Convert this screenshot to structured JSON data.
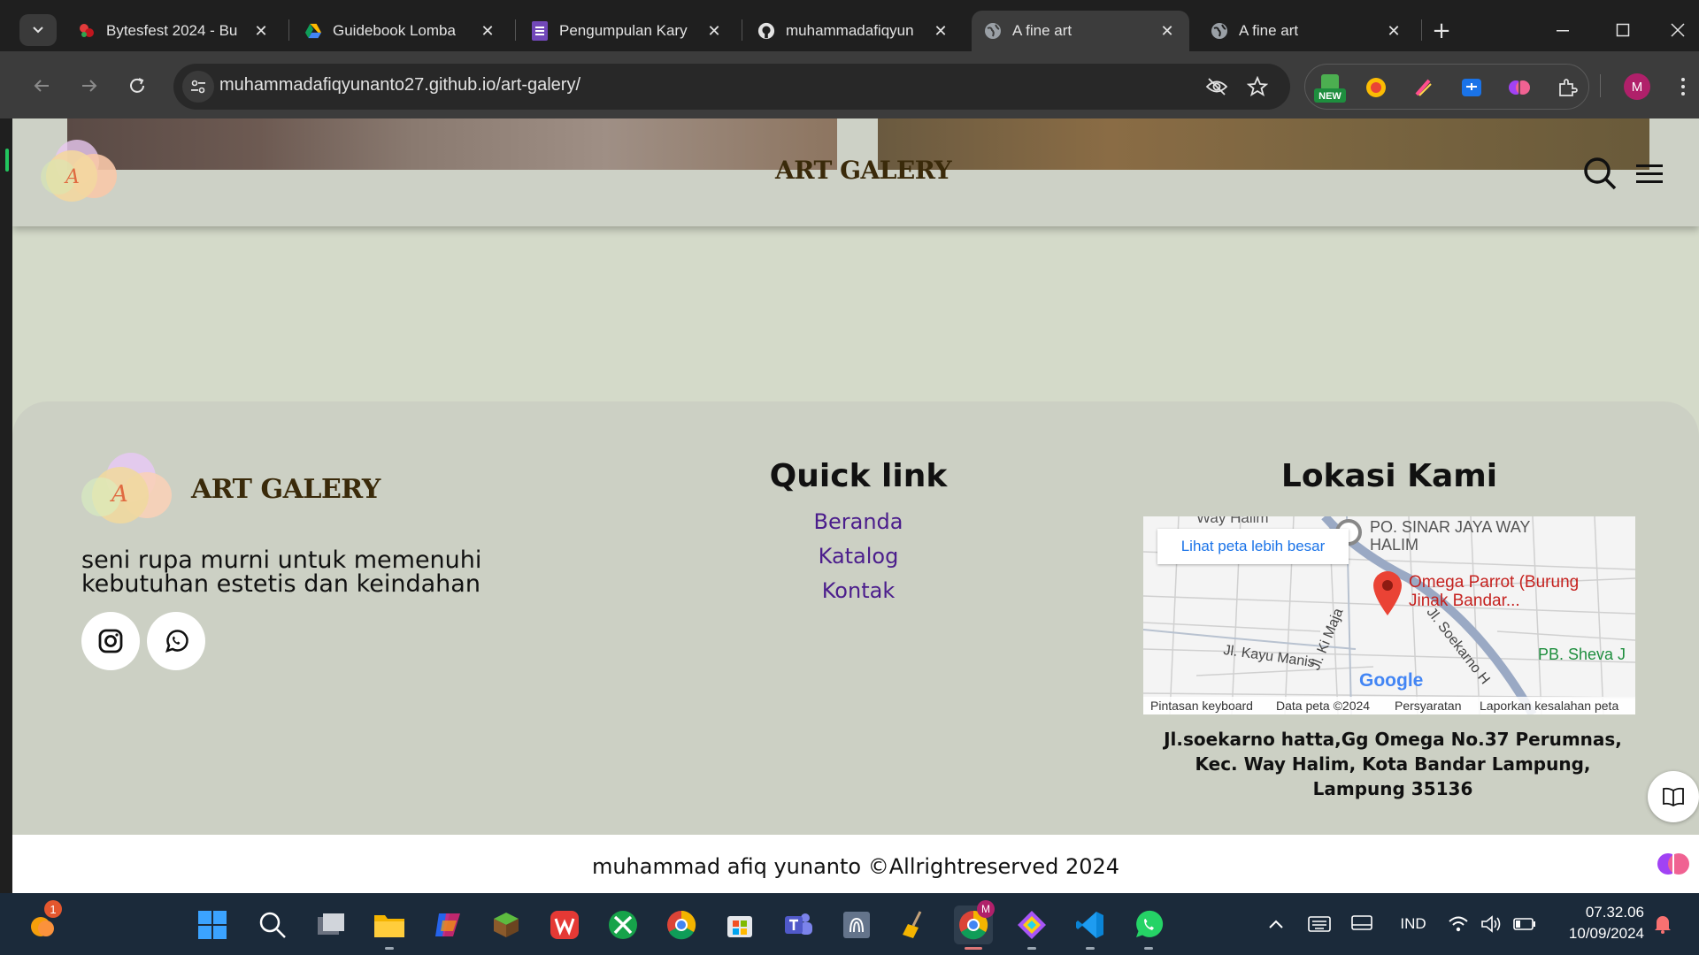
{
  "browser": {
    "tabs": [
      {
        "title": "Bytesfest 2024 - Bu",
        "icon": "bytesfest-favicon"
      },
      {
        "title": "Guidebook Lomba",
        "icon": "google-drive-icon"
      },
      {
        "title": "Pengumpulan Kary",
        "icon": "google-forms-icon"
      },
      {
        "title": "muhammadafiqyun",
        "icon": "github-icon"
      },
      {
        "title": "A fine art",
        "icon": "globe-icon",
        "active": true
      },
      {
        "title": "A fine art",
        "icon": "globe-icon"
      }
    ],
    "url": "muhammadafiqyunanto27.github.io/art-galery/",
    "avatar_initial": "M",
    "new_badge": "NEW"
  },
  "header": {
    "brand": "ART GALERY",
    "logo_letter": "A"
  },
  "footer": {
    "brand": "ART GALERY",
    "logo_letter": "A",
    "tagline": "seni rupa murni untuk memenuhi kebutuhan estetis dan keindahan",
    "quick_link_title": "Quick link",
    "links": [
      "Beranda",
      "Katalog",
      "Kontak"
    ],
    "location_title": "Lokasi Kami",
    "map": {
      "button": "Lihat peta lebih besar",
      "place_top": "PO. SINAR JAYA WAY HALIM",
      "pin_label": "Omega Parrot (Burung Jinak Bandar...",
      "road_1": "Jl. Kayu Manis",
      "road_2": "Jl. Ki Maja",
      "road_3": "Jl. Soekarno H",
      "place_right": "PB. Sheva J",
      "top_cut": "Way Halim",
      "google": "Google",
      "foot": [
        "Pintasan keyboard",
        "Data peta ©2024",
        "Persyaratan",
        "Laporkan kesalahan peta"
      ]
    },
    "address": "Jl.soekarno hatta,Gg Omega No.37 Perumnas, Kec. Way Halim, Kota Bandar Lampung, Lampung 35136",
    "copyright": "muhammad afiq yunanto ©Allrightreserved 2024"
  },
  "taskbar": {
    "weather_badge": "1",
    "lang": "IND",
    "time": "07.32.06",
    "date": "10/09/2024",
    "chrome_badge": "M"
  },
  "colors": {
    "page_bg": "#d4dac9",
    "footer_bg": "#ccd0c4",
    "brand": "#3a2a0a",
    "link": "#4b1d8c"
  }
}
